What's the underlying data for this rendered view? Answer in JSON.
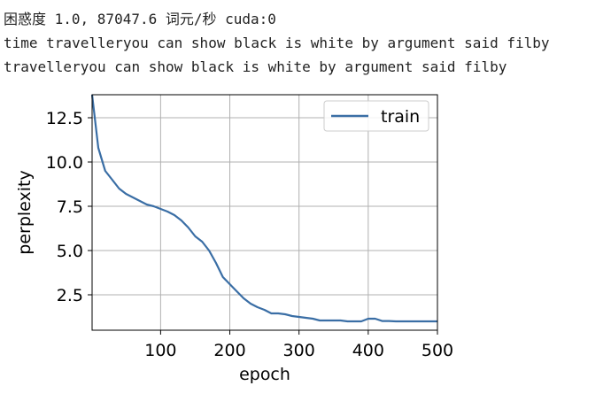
{
  "output": {
    "line1": "困惑度 1.0, 87047.6 词元/秒 cuda:0",
    "line2": "time travelleryou can show black is white by argument said filby",
    "line3": "travelleryou can show black is white by argument said filby"
  },
  "chart_data": {
    "type": "line",
    "title": "",
    "xlabel": "epoch",
    "ylabel": "perplexity",
    "xlim": [
      1,
      500
    ],
    "ylim": [
      0.5,
      13.8
    ],
    "xticks": [
      100,
      200,
      300,
      400,
      500
    ],
    "yticks": [
      2.5,
      5.0,
      7.5,
      10.0,
      12.5
    ],
    "xtick_labels": [
      "100",
      "200",
      "300",
      "400",
      "500"
    ],
    "ytick_labels": [
      "2.5",
      "5.0",
      "7.5",
      "10.0",
      "12.5"
    ],
    "grid": true,
    "legend_position": "upper right",
    "series": [
      {
        "name": "train",
        "color": "#3a6ea5",
        "x": [
          1,
          10,
          20,
          30,
          40,
          50,
          60,
          70,
          80,
          90,
          100,
          110,
          120,
          130,
          140,
          150,
          160,
          170,
          180,
          190,
          200,
          210,
          220,
          230,
          240,
          250,
          260,
          270,
          280,
          290,
          300,
          310,
          320,
          330,
          340,
          350,
          360,
          370,
          380,
          390,
          400,
          410,
          420,
          430,
          440,
          450,
          460,
          470,
          480,
          490,
          500
        ],
        "values": [
          13.8,
          10.8,
          9.5,
          9.0,
          8.5,
          8.2,
          8.0,
          7.8,
          7.6,
          7.5,
          7.35,
          7.2,
          7.0,
          6.7,
          6.3,
          5.8,
          5.5,
          5.0,
          4.3,
          3.5,
          3.1,
          2.7,
          2.3,
          2.0,
          1.8,
          1.65,
          1.45,
          1.45,
          1.4,
          1.3,
          1.25,
          1.2,
          1.15,
          1.05,
          1.05,
          1.05,
          1.05,
          1.0,
          1.0,
          1.0,
          1.15,
          1.15,
          1.02,
          1.02,
          1.0,
          1.0,
          1.0,
          1.0,
          1.0,
          1.0,
          1.0
        ]
      }
    ]
  }
}
